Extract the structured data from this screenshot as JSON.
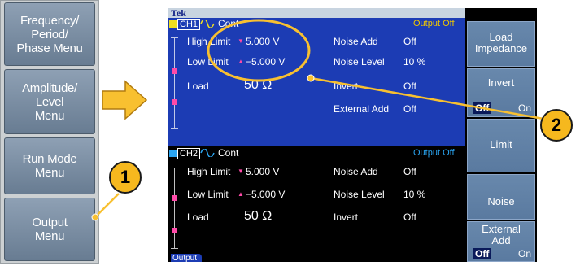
{
  "left_menu": {
    "buttons": [
      {
        "label": "Frequency/\nPeriod/\nPhase Menu"
      },
      {
        "label": "Amplitude/\nLevel\nMenu"
      },
      {
        "label": "Run Mode\nMenu"
      },
      {
        "label": "Output\nMenu"
      }
    ]
  },
  "screen": {
    "brand": "Tek",
    "ch1": {
      "label": "CH1",
      "mode": "Cont",
      "status": "Output Off",
      "high_limit_label": "High Limit",
      "high_limit_value": "5.000 V",
      "low_limit_label": "Low Limit",
      "low_limit_value": "−5.000 V",
      "load_label": "Load",
      "load_value": "50 Ω",
      "noise_add_label": "Noise Add",
      "noise_add_value": "Off",
      "noise_level_label": "Noise Level",
      "noise_level_value": "10 %",
      "invert_label": "Invert",
      "invert_value": "Off",
      "external_add_label": "External Add",
      "external_add_value": "Off"
    },
    "ch2": {
      "label": "CH2",
      "mode": "Cont",
      "status": "Output Off",
      "high_limit_label": "High Limit",
      "high_limit_value": "5.000 V",
      "low_limit_label": "Low Limit",
      "low_limit_value": "−5.000 V",
      "load_label": "Load",
      "load_value": "50 Ω",
      "noise_add_label": "Noise Add",
      "noise_add_value": "Off",
      "noise_level_label": "Noise Level",
      "noise_level_value": "10 %",
      "invert_label": "Invert",
      "invert_value": "Off"
    },
    "tab_label": "Output"
  },
  "right_menu": {
    "load_impedance": "Load\nImpedance",
    "invert": "Invert",
    "invert_off": "Off",
    "invert_on": "On",
    "limit": "Limit",
    "noise": "Noise",
    "external_add": "External\nAdd",
    "external_off": "Off",
    "external_on": "On"
  },
  "callouts": {
    "one": "1",
    "two": "2"
  },
  "colors": {
    "ch1": "#f0e020",
    "ch2": "#2aa4f0",
    "status": "#f0c800",
    "status2": "#2aa4f0",
    "callout": "#f6b81e"
  }
}
